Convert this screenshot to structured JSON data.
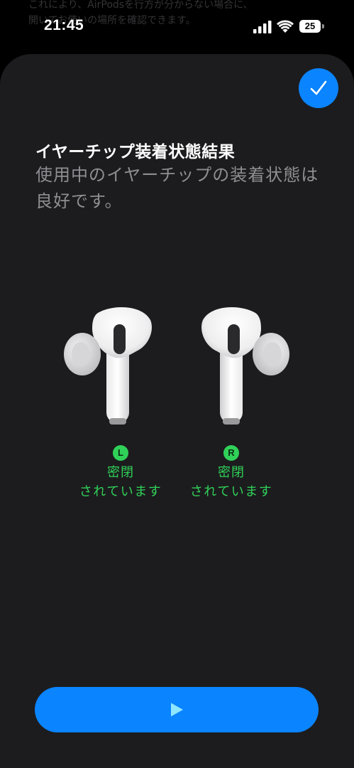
{
  "background_page": {
    "line1": "これにより、AirPodsを行方が分からない場合に、",
    "line2": "開いてお使いの場所を確認できます。"
  },
  "status_bar": {
    "time": "21:45",
    "battery_level": "25",
    "signal_icon": "cellular-signal-icon",
    "wifi_icon": "wifi-icon"
  },
  "sheet": {
    "done_icon": "checkmark-icon",
    "title": "イヤーチップ装着状態結果",
    "subtitle": "使用中のイヤーチップの装着状態は良好です。",
    "left": {
      "badge": "L",
      "status_line1": "密閉",
      "status_line2": "されています"
    },
    "right": {
      "badge": "R",
      "status_line1": "密閉",
      "status_line2": "されています"
    },
    "play_icon": "play-icon"
  },
  "colors": {
    "accent": "#0a84ff",
    "success": "#30d158",
    "sheet_bg": "#1c1c1e",
    "secondary_text": "#8e8e93"
  }
}
